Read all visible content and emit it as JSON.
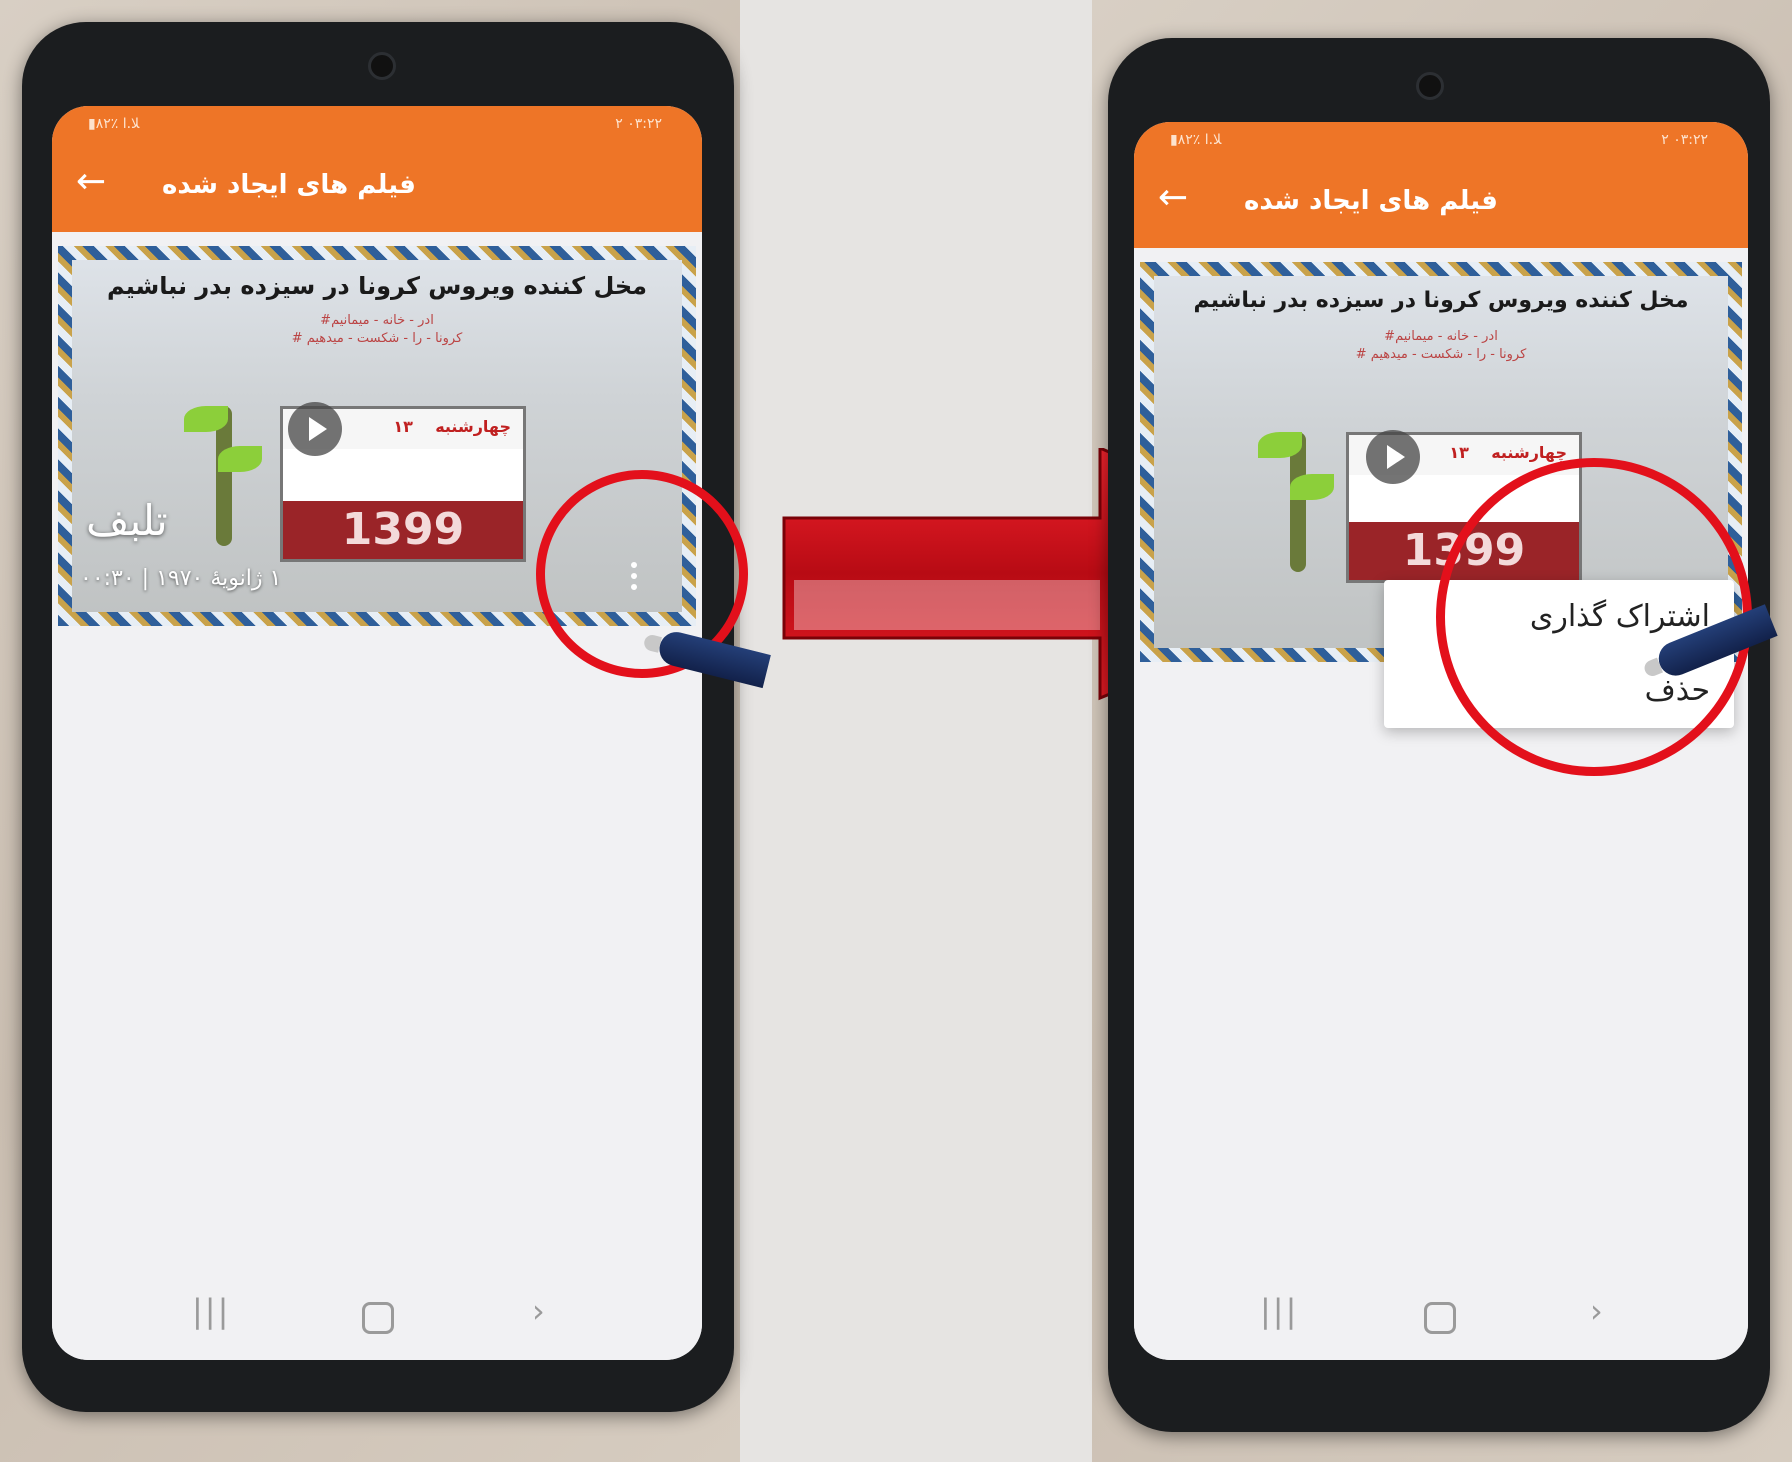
{
  "screens": [
    {
      "status_left": "▮۸۲٪ ﻼ.ﺍ",
      "status_right": "۲ ۰۳:۲۲",
      "title": "فیلم های ایجاد شده",
      "back_icon": "←",
      "card": {
        "headline": "ﻣﺨﻞ ﮐﻨﻨﺪﻩ ﻭﯾﺮﻭﺱ ﮐﺮﻭﻧﺎ ﺩﺭ ﺳﯿﺰﺩﻩ ﺑﺪﺭ ﻧﺒﺎﺷﯿﻢ",
        "hashtag_line1": "#ﺍﺩﺭ - ﺧﺎﻧﻪ - ﻣﯿﻤﺎﻧﯿﻢ",
        "hashtag_line2": "# ﮐﺮﻭﻧﺎ - ﺭﺍ - ﺷﮑﺴﺖ - ﻣﯿﺪﻫﯿﻢ",
        "calendar_day": "ﭼﻬﺎﺭﺷﻨﺒﻪ",
        "calendar_num": "۱۳",
        "calendar_year": "1399",
        "label": "تلبف",
        "meta": "١ ژانویهٔ ۱۹۷۰ | ۰۰:۳۰"
      },
      "nav": {
        "recent": "|||",
        "back": "›"
      }
    },
    {
      "status_left": "▮۸۲٪ ﻼ.ﺍ",
      "status_right": "۲ ۰۳:۲۲",
      "title": "فیلم های ایجاد شده",
      "back_icon": "←",
      "card": {
        "headline": "ﻣﺨﻞ ﮐﻨﻨﺪﻩ ﻭﯾﺮﻭﺱ ﮐﺮﻭﻧﺎ ﺩﺭ ﺳﯿﺰﺩﻩ ﺑﺪﺭ ﻧﺒﺎﺷﯿﻢ",
        "hashtag_line1": "#ﺍﺩﺭ - ﺧﺎﻧﻪ - ﻣﯿﻤﺎﻧﯿﻢ",
        "hashtag_line2": "# ﮐﺮﻭﻧﺎ - ﺭﺍ - ﺷﮑﺴﺖ - ﻣﯿﺪﻫﯿﻢ",
        "calendar_day": "ﭼﻬﺎﺭﺷﻨﺒﻪ",
        "calendar_num": "۱۳",
        "calendar_year": "1399"
      },
      "menu": {
        "share": "اشتراک گذاری",
        "delete": "حذف"
      },
      "nav": {
        "recent": "|||",
        "back": "›"
      }
    }
  ],
  "colors": {
    "accent": "#ee7527",
    "highlight": "#e3101b",
    "arrow": "#d3111d"
  }
}
